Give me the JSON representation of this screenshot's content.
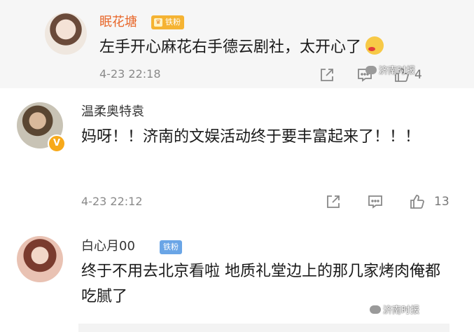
{
  "comments": [
    {
      "username": "眠花塘",
      "badge": "铁粉",
      "text": "左手开心麻花右手德云剧社，太开心了",
      "time": "4-23 22:18",
      "likes": "4",
      "username_color": "#e8672a"
    },
    {
      "username": "温柔奥特袁",
      "verified": "V",
      "text": "妈呀！！济南的文娱活动终于要丰富起来了！！！",
      "time": "4-23 22:12",
      "likes": "13"
    },
    {
      "username": "白心月00",
      "badge": "铁粉",
      "text": "终于不用去北京看啦 地质礼堂边上的那几家烤肉俺都吃腻了"
    }
  ],
  "watermark": "济南时报",
  "icons": {
    "share": "share-icon",
    "comment": "comment-icon",
    "like": "thumbs-up-icon",
    "emoji": "blush-emoji-icon"
  },
  "colors": {
    "badge_orange": "#f5b332",
    "badge_blue": "#6aa5e6",
    "highlight_bg": "#f6f6f6"
  }
}
